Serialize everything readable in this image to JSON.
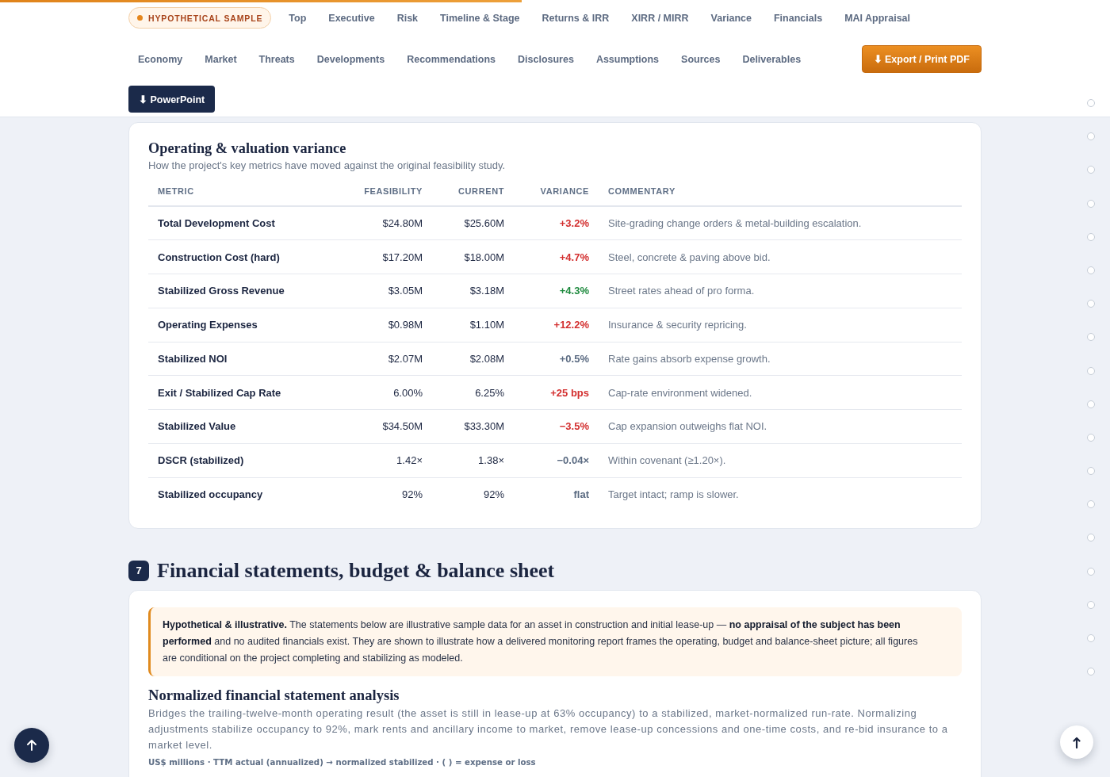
{
  "reading_progress": {
    "level": 0.47
  },
  "header": {
    "badge": "HYPOTHETICAL SAMPLE",
    "link_rows": [
      {
        "links": [
          "Top",
          "Executive",
          "Risk",
          "Timeline & Stage",
          "Returns & IRR",
          "XIRR / MIRR",
          "Variance",
          "Financials",
          "MAI Appraisal"
        ]
      },
      {
        "links": [
          "Economy",
          "Market",
          "Threats",
          "Developments",
          "Recommendations",
          "Disclosures",
          "Assumptions",
          "Sources",
          "Deliverables"
        ]
      }
    ],
    "export_button": "⬇ Export / Print PDF",
    "powerpoint_button": "⬇ PowerPoint"
  },
  "variance_card": {
    "title": "Operating & valuation variance",
    "subtitle": "How the project's key metrics have moved against the original feasibility study.",
    "table": {
      "columns": [
        "METRIC",
        "FEASIBILITY",
        "CURRENT",
        "VARIANCE",
        "COMMENTARY"
      ],
      "rows": [
        {
          "metric": "Total Development Cost",
          "feasibility": "$24.80M",
          "current": "$25.60M",
          "variance": "+3.2%",
          "color": "#d32f2f",
          "commentary": "Site-grading change orders & metal-building escalation."
        },
        {
          "metric": "Construction Cost (hard)",
          "feasibility": "$17.20M",
          "current": "$18.00M",
          "variance": "+4.7%",
          "color": "#d32f2f",
          "commentary": "Steel, concrete & paving above bid."
        },
        {
          "metric": "Stabilized Gross Revenue",
          "feasibility": "$3.05M",
          "current": "$3.18M",
          "variance": "+4.3%",
          "color": "#1e8a3e",
          "commentary": "Street rates ahead of pro forma."
        },
        {
          "metric": "Operating Expenses",
          "feasibility": "$0.98M",
          "current": "$1.10M",
          "variance": "+12.2%",
          "color": "#d32f2f",
          "commentary": "Insurance & security repricing."
        },
        {
          "metric": "Stabilized NOI",
          "feasibility": "$2.07M",
          "current": "$2.08M",
          "variance": "+0.5%",
          "color": "#5b6b82",
          "commentary": "Rate gains absorb expense growth."
        },
        {
          "metric": "Exit / Stabilized Cap Rate",
          "feasibility": "6.00%",
          "current": "6.25%",
          "variance": "+25 bps",
          "color": "#d32f2f",
          "commentary": "Cap-rate environment widened."
        },
        {
          "metric": "Stabilized Value",
          "feasibility": "$34.50M",
          "current": "$33.30M",
          "variance": "−3.5%",
          "color": "#d32f2f",
          "commentary": "Cap expansion outweighs flat NOI."
        },
        {
          "metric": "DSCR (stabilized)",
          "feasibility": "1.42×",
          "current": "1.38×",
          "variance": "−0.04×",
          "color": "#5b6b82",
          "commentary": "Within covenant (≥1.20×)."
        },
        {
          "metric": "Stabilized occupancy",
          "feasibility": "92%",
          "current": "92%",
          "variance": "flat",
          "color": "#5b6b82",
          "commentary": "Target intact; ramp is slower."
        }
      ]
    }
  },
  "section": {
    "number": "7",
    "title": "Financial statements, budget & balance sheet",
    "callout": "**Hypothetical & illustrative.** The statements below are illustrative sample data for an asset in construction and initial lease-up — **no appraisal of the subject has been performed** and no audited financials exist. They are shown to illustrate how a delivered monitoring report frames the operating, budget and balance-sheet picture; all figures are conditional on the project completing and stabilizing as modeled.",
    "subheading": "Normalized financial statement analysis",
    "paragraph": "Bridges the trailing-twelve-month operating result (the asset is still in lease-up at 63% occupancy) to a stabilized, market-normalized run-rate. Normalizing adjustments stabilize occupancy to 92%, mark rents and ancillary income to market, remove lease-up concessions and one-time costs, and re-bid insurance to a market level.",
    "units_note": "US$ millions · TTM actual (annualized) → normalized stabilized · ( ) = expense or loss"
  },
  "section_dots": [
    {
      "selected": false
    },
    {
      "selected": false
    },
    {
      "selected": false
    },
    {
      "selected": false
    },
    {
      "selected": false
    },
    {
      "selected": false
    },
    {
      "selected": false
    },
    {
      "selected": false
    },
    {
      "selected": false
    },
    {
      "selected": false
    },
    {
      "selected": false
    },
    {
      "selected": false
    },
    {
      "selected": false
    },
    {
      "selected": false
    },
    {
      "selected": false
    },
    {
      "selected": false
    },
    {
      "selected": false
    },
    {
      "selected": false
    }
  ]
}
